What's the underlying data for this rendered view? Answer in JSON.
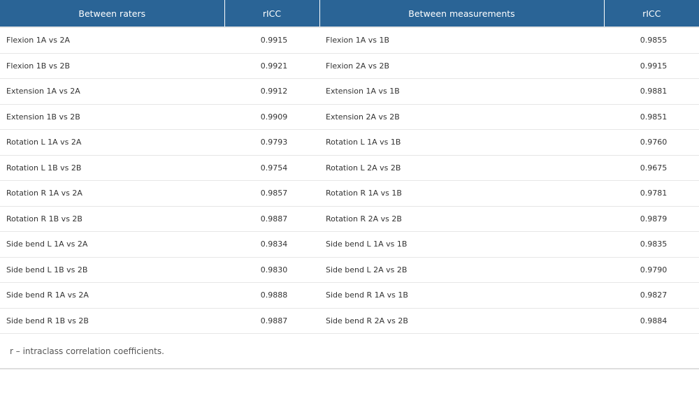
{
  "table": {
    "headers": [
      "Between raters",
      "rICC",
      "Between measurements",
      "rICC"
    ],
    "rows": [
      [
        "Flexion 1A vs 2A",
        "0.9915",
        "Flexion 1A vs 1B",
        "0.9855"
      ],
      [
        "Flexion 1B vs 2B",
        "0.9921",
        "Flexion 2A vs 2B",
        "0.9915"
      ],
      [
        "Extension 1A vs 2A",
        "0.9912",
        "Extension 1A vs 1B",
        "0.9881"
      ],
      [
        "Extension 1B vs 2B",
        "0.9909",
        "Extension 2A vs 2B",
        "0.9851"
      ],
      [
        "Rotation L 1A vs 2A",
        "0.9793",
        "Rotation L 1A vs 1B",
        "0.9760"
      ],
      [
        "Rotation L 1B vs 2B",
        "0.9754",
        "Rotation L 2A vs 2B",
        "0.9675"
      ],
      [
        "Rotation R 1A vs 2A",
        "0.9857",
        "Rotation R 1A vs 1B",
        "0.9781"
      ],
      [
        "Rotation R 1B vs 2B",
        "0.9887",
        "Rotation R 2A vs 2B",
        "0.9879"
      ],
      [
        "Side bend L 1A vs 2A",
        "0.9834",
        "Side bend L 1A vs 1B",
        "0.9835"
      ],
      [
        "Side bend L 1B vs 2B",
        "0.9830",
        "Side bend L 2A vs 2B",
        "0.9790"
      ],
      [
        "Side bend R 1A vs 2A",
        "0.9888",
        "Side bend R 1A vs 1B",
        "0.9827"
      ],
      [
        "Side bend R 1B vs 2B",
        "0.9887",
        "Side bend R 2A vs 2B",
        "0.9884"
      ]
    ],
    "footnote": "r – intraclass correlation coefficients."
  },
  "colors": {
    "header_bg": "#2a6496",
    "header_text": "#ffffff",
    "row_border": "#e6e6e6"
  }
}
